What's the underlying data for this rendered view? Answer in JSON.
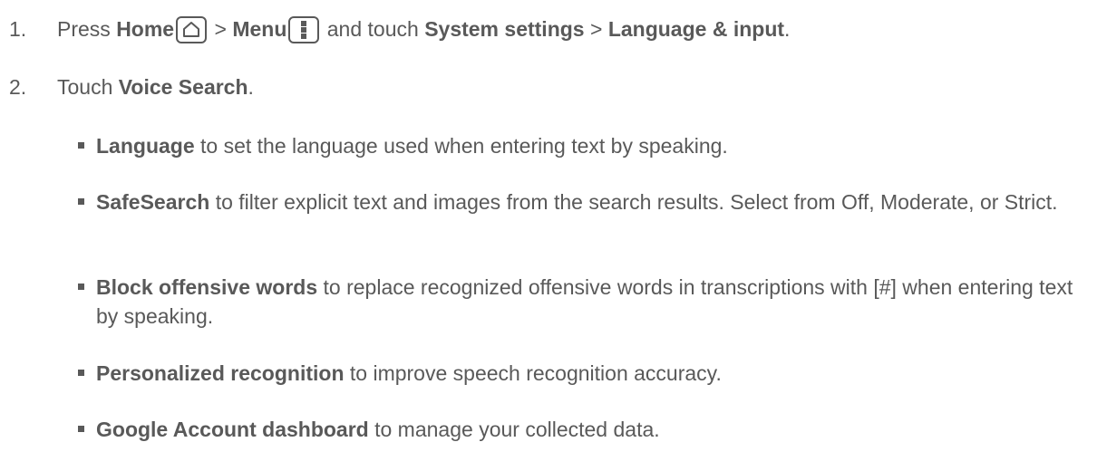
{
  "steps": [
    {
      "num": "1.",
      "parts": {
        "a": "Press ",
        "home": "Home",
        "b": " > ",
        "menu": "Menu",
        "c": " and touch ",
        "system_settings": "System settings",
        "d": " > ",
        "language_input": "Language & input",
        "e": "."
      },
      "icons": [
        "home-icon",
        "menu-icon"
      ]
    },
    {
      "num": "2.",
      "parts": {
        "a": "Touch ",
        "voice_search": "Voice Search",
        "b": "."
      }
    }
  ],
  "bullets": [
    {
      "term": "Language",
      "desc": " to set the language used when entering text by speaking."
    },
    {
      "term": "SafeSearch",
      "desc": " to filter explicit text and images from the search results. Select from Off, Moderate, or Strict."
    },
    {
      "term": "Block offensive words",
      "desc": " to replace recognized offensive words in transcriptions with [#] when entering text by speaking."
    },
    {
      "term": "Personalized recognition",
      "desc": " to improve speech recognition accuracy."
    },
    {
      "term": "Google Account dashboard",
      "desc": " to manage your collected data."
    }
  ],
  "colors": {
    "text": "#595959"
  }
}
